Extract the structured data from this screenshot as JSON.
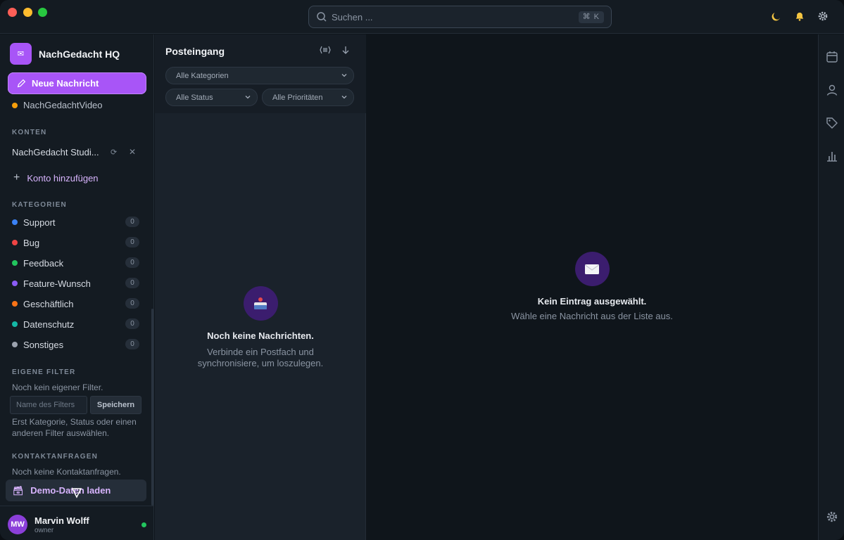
{
  "titlebar": {
    "search_placeholder": "Suchen ...",
    "search_shortcut": "⌘ K"
  },
  "sidebar": {
    "brand_name": "NachGedacht HQ",
    "compose_label": "Neue Nachricht",
    "partial_item": "NachGedachtVideo",
    "accounts_label": "KONTEN",
    "account_name": "NachGedacht Studi...",
    "add_account_label": "Konto hinzufügen",
    "categories_label": "KATEGORIEN",
    "categories": [
      {
        "label": "Support",
        "count": "0",
        "color": "#3b82f6"
      },
      {
        "label": "Bug",
        "count": "0",
        "color": "#ef4444"
      },
      {
        "label": "Feedback",
        "count": "0",
        "color": "#22c55e"
      },
      {
        "label": "Feature-Wunsch",
        "count": "0",
        "color": "#8b5cf6"
      },
      {
        "label": "Geschäftlich",
        "count": "0",
        "color": "#f97316"
      },
      {
        "label": "Datenschutz",
        "count": "0",
        "color": "#14b8a6"
      },
      {
        "label": "Sonstiges",
        "count": "0",
        "color": "#9ca3af"
      }
    ],
    "filters_label": "EIGENE FILTER",
    "no_filter_text": "Noch kein eigener Filter.",
    "filter_placeholder": "Name des Filters",
    "filter_save_label": "Speichern",
    "filter_hint": "Erst Kategorie, Status oder einen anderen Filter auswählen.",
    "contacts_label": "KONTAKTANFRAGEN",
    "no_contacts_text": "Noch keine Kontaktanfragen.",
    "demo_button_label": "Demo-Daten laden",
    "user": {
      "initials": "MW",
      "name": "Marvin Wolff",
      "role": "owner"
    }
  },
  "inbox": {
    "title": "Posteingang",
    "filter_category": "Alle Kategorien",
    "filter_status": "Alle Status",
    "filter_priority": "Alle Prioritäten",
    "empty_title": "Noch keine Nachrichten.",
    "empty_desc": "Verbinde ein Postfach und synchronisiere, um loszulegen."
  },
  "detail": {
    "empty_title": "Kein Eintrag ausgewählt.",
    "empty_desc": "Wähle eine Nachricht aus der Liste aus."
  },
  "colors": {
    "accent": "#a855f7",
    "partial_item_dot": "#f59e0b",
    "online": "#22c55e"
  }
}
